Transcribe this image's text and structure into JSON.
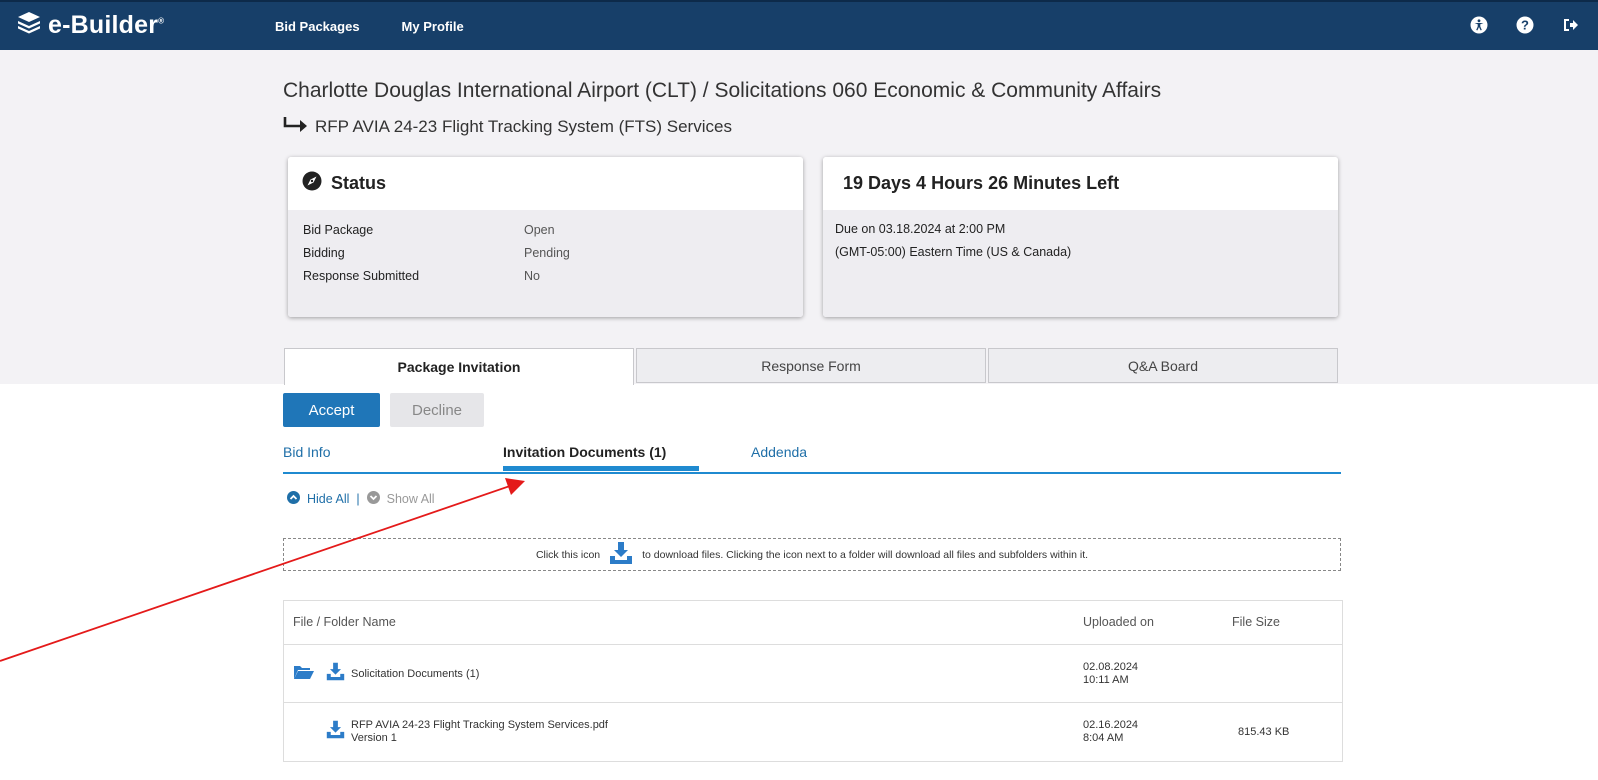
{
  "header": {
    "logo_text": "e-Builder",
    "logo_mark": "®",
    "nav": [
      "Bid Packages",
      "My Profile"
    ],
    "icons": [
      "accessibility-icon",
      "help-icon",
      "logout-icon"
    ]
  },
  "breadcrumb": {
    "title": "Charlotte Douglas International Airport (CLT) / Solicitations 060 Economic & Community Affairs",
    "subtitle": "RFP AVIA 24-23 Flight Tracking System (FTS) Services"
  },
  "status_card": {
    "title": "Status",
    "rows": [
      {
        "label": "Bid Package",
        "value": "Open"
      },
      {
        "label": "Bidding",
        "value": "Pending"
      },
      {
        "label": "Response Submitted",
        "value": "No"
      }
    ]
  },
  "deadline_card": {
    "title": "19 Days 4 Hours 26 Minutes Left",
    "due": "Due on 03.18.2024 at 2:00 PM",
    "timezone": "(GMT-05:00) Eastern Time (US & Canada)"
  },
  "tabs": [
    "Package Invitation",
    "Response Form",
    "Q&A Board"
  ],
  "actions": {
    "accept": "Accept",
    "decline": "Decline"
  },
  "subtabs": [
    "Bid Info",
    "Invitation Documents (1)",
    "Addenda"
  ],
  "toggles": {
    "hide_all": "Hide All",
    "separator": "|",
    "show_all": "Show All"
  },
  "hint": {
    "before": "Click this icon",
    "after": "to download files. Clicking the icon next to a folder will download all files and subfolders within it."
  },
  "table": {
    "headers": [
      "File / Folder Name",
      "Uploaded on",
      "File Size"
    ],
    "rows": [
      {
        "name": "Solicitation Documents (1)",
        "version": "",
        "date": "02.08.2024",
        "time": "10:11 AM",
        "size": ""
      },
      {
        "name": "RFP AVIA 24-23 Flight Tracking System Services.pdf",
        "version": "Version 1",
        "date": "02.16.2024",
        "time": "8:04 AM",
        "size": "815.43 KB"
      }
    ]
  },
  "colors": {
    "header_bg": "#173f69",
    "accent": "#1f8ad0",
    "button": "#1f76b8",
    "annotation": "#e41a1a"
  }
}
